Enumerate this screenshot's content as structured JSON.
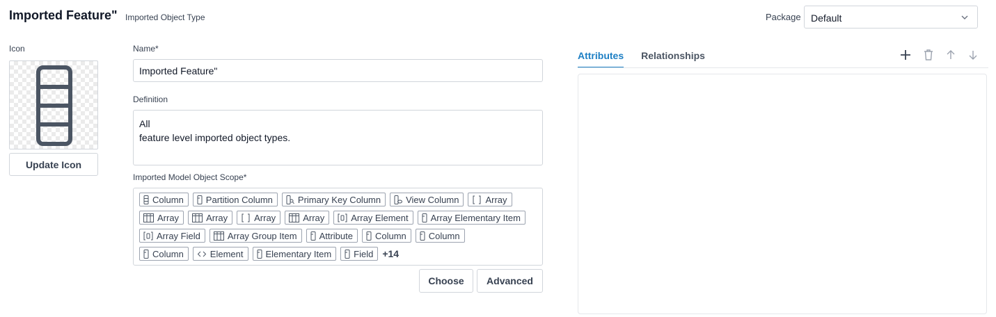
{
  "header": {
    "title": "Imported Feature\"",
    "subtitle": "Imported Object Type",
    "package_label": "Package",
    "package_value": "Default"
  },
  "icon_section": {
    "label": "Icon",
    "icon_name": "column-icon",
    "update_button": "Update Icon"
  },
  "form": {
    "name_label": "Name*",
    "name_value": "Imported Feature\"",
    "definition_label": "Definition",
    "definition_line1": "All",
    "definition_line2": "feature level imported object types.",
    "scope_label": "Imported Model Object Scope*",
    "scope_rows": [
      [
        {
          "label": "Column",
          "icon": "column-icon"
        },
        {
          "label": "Partition Column",
          "icon": "partition-column-icon"
        },
        {
          "label": "Primary Key Column",
          "icon": "primary-key-column-icon"
        },
        {
          "label": "View Column",
          "icon": "view-column-icon"
        },
        {
          "label": "Array",
          "icon": "brackets-icon"
        }
      ],
      [
        {
          "label": "Array",
          "icon": "table-icon"
        },
        {
          "label": "Array",
          "icon": "table-icon"
        },
        {
          "label": "Array",
          "icon": "brackets-icon"
        },
        {
          "label": "Array",
          "icon": "table-icon"
        },
        {
          "label": "Array Element",
          "icon": "array-element-icon"
        },
        {
          "label": "Array Elementary Item",
          "icon": "field-icon"
        }
      ],
      [
        {
          "label": "Array Field",
          "icon": "array-element-icon"
        },
        {
          "label": "Array Group Item",
          "icon": "table-icon"
        },
        {
          "label": "Attribute",
          "icon": "field-icon"
        },
        {
          "label": "Column",
          "icon": "field-icon"
        },
        {
          "label": "Column",
          "icon": "field-icon"
        }
      ],
      [
        {
          "label": "Column",
          "icon": "field-icon"
        },
        {
          "label": "Element",
          "icon": "code-icon"
        },
        {
          "label": "Elementary Item",
          "icon": "field-icon"
        },
        {
          "label": "Field",
          "icon": "field-icon"
        }
      ]
    ],
    "scope_more": "+14",
    "choose_button": "Choose",
    "advanced_button": "Advanced"
  },
  "right_panel": {
    "tabs": [
      {
        "label": "Attributes",
        "active": true
      },
      {
        "label": "Relationships",
        "active": false
      }
    ],
    "tools": [
      "plus-icon",
      "trash-icon",
      "arrow-up-icon",
      "arrow-down-icon"
    ]
  },
  "colors": {
    "accent": "#1d7fc4",
    "border": "#d1d5db",
    "icon_stroke": "#4b5563"
  }
}
